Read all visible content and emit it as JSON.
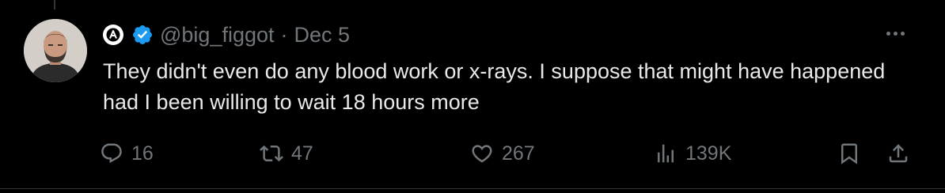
{
  "tweet": {
    "handle": "@big_figgot",
    "separator": "·",
    "date": "Dec 5",
    "text": "They didn't even do any blood work or x-rays. I suppose that might have happened had I been willing to wait 18 hours more",
    "verified": true
  },
  "actions": {
    "replies": "16",
    "reposts": "47",
    "likes": "267",
    "views": "139K"
  },
  "icons": {
    "brand_badge": "circle-a-icon",
    "verified": "verified-badge-icon",
    "more": "more-horizontal-icon",
    "reply": "reply-icon",
    "repost": "repost-icon",
    "like": "heart-icon",
    "views": "views-chart-icon",
    "bookmark": "bookmark-icon",
    "share": "share-icon"
  },
  "colors": {
    "background": "#000000",
    "text": "#e7e9ea",
    "muted": "#71767b",
    "verified": "#1d9bf0"
  }
}
